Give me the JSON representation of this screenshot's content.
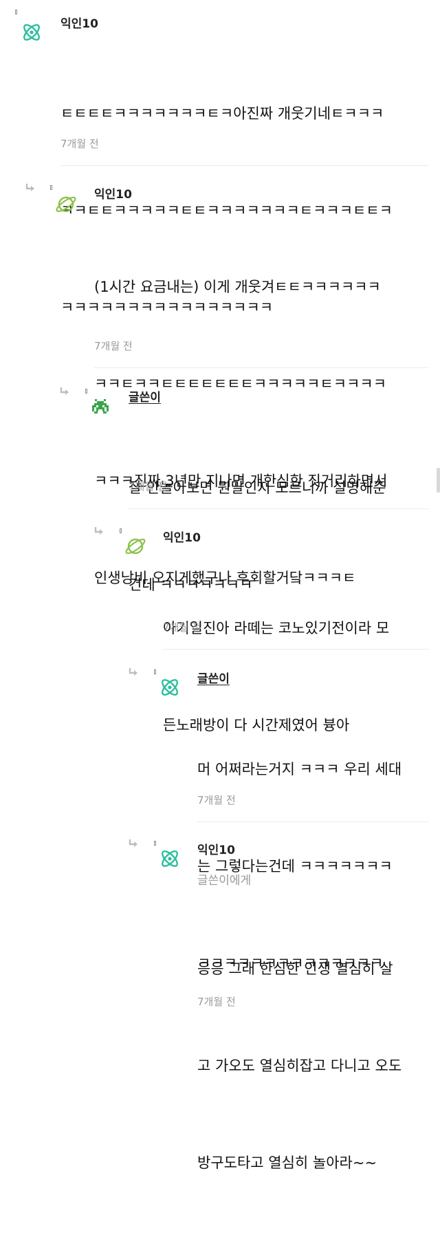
{
  "comments": [
    {
      "author": "익인10",
      "mention": "",
      "lines": [
        "ㅌㅌㅌㅌㅋㅋㅋㅋㅋㅋㅋㅌㅋ아진짜 개웃기네ㅌㅋㅋㅋ",
        "ㅋㅋㅌㅌㅋㅋㅋㅋㅋㅌㅌㅋㅋㅋㅋㅋㅋㅋㅌㅋㅋㅋㅌㅌㅋ",
        "ㅋㅋㅋㅋㅋㅋㅋㅋㅋㅋㅋㅋㅋㅋㅋㅋ"
      ],
      "time": "7개월 전",
      "avatar": "atom-icon"
    },
    {
      "author": "익인10",
      "mention": "",
      "lines": [
        "(1시간 요금내는) 이게 개웃겨ㅌㅌㅋㅋㅋㅋㅋㅋ",
        "ㅋㅋㅌㅋㅋㅌㅌㅌㅌㅌㅌㅌㅋㅋㅋㅋㅋㅌㅋㅋㅋㅋ",
        "ㅋㅋㅋ진짜 3년만 지나면 개한심한 짓거리하면서",
        "인생낭비 오지게했구나 후회할거닼ㅋㅋㅋㅌ"
      ],
      "time": "7개월 전",
      "avatar": "planet-icon"
    },
    {
      "author": "글쓴이",
      "mention": "",
      "lines": [
        "잘 안놀아보면 뭔말인지 모르니까 설명해준",
        "건데 ㅋㅋㅋㅋㅋㅋㅋ"
      ],
      "time": "7개월 전",
      "avatar": "space-invader-icon"
    },
    {
      "author": "익인10",
      "mention": "",
      "lines": [
        "아기일진아 라떼는 코노있기전이라 모",
        "든노래방이 다 시간제였어 븅아"
      ],
      "time": "7개월 전",
      "avatar": "planet-icon"
    },
    {
      "author": "글쓴이",
      "mention": "",
      "lines": [
        "머 어쩌라는거지 ㅋㅋㅋ 우리 세대",
        "는 그렇다는건데 ㅋㅋㅋㅋㅋㅋㅋ",
        "ㅋㅋㅋㅋㅋㅋㅋㅋㅋㅋㅋㅋㅋㅋ"
      ],
      "time": "7개월 전",
      "avatar": "atom-icon"
    },
    {
      "author": "익인10",
      "mention": "글쓴이에게",
      "lines": [
        "응응 그래 한심한 인생 열심히 살",
        "고 가오도 열심히잡고 다니고 오도",
        "방구도타고 열심히 놀아라~~"
      ],
      "time": "7개월 전",
      "avatar": "atom-icon"
    }
  ],
  "colors": {
    "atom": "#2bbf9d",
    "planet": "#8bc34a",
    "invader": "#3aa64a",
    "muted": "#999999"
  }
}
